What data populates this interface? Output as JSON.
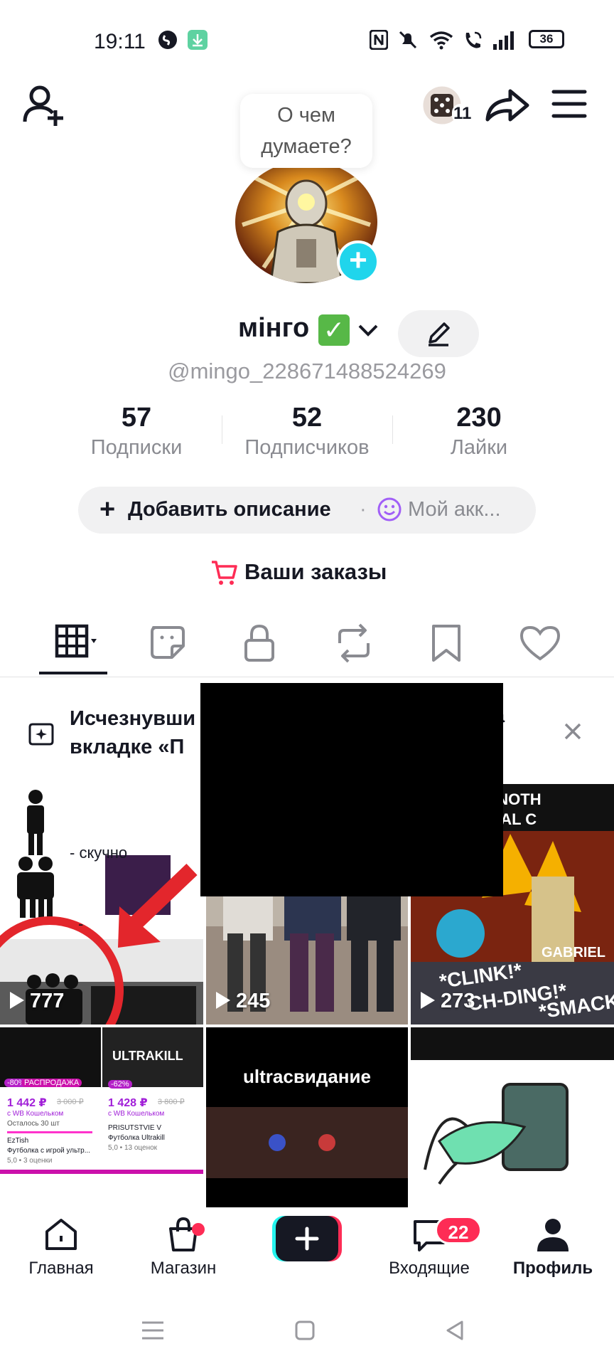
{
  "status_bar": {
    "time": "19:11",
    "battery": "36",
    "icons": [
      "shazam-icon",
      "download-icon",
      "nfc-icon",
      "mute-icon",
      "wifi-icon",
      "wifi-call-icon",
      "signal-icon",
      "battery-icon"
    ]
  },
  "header": {
    "friends_count": "11",
    "thought_bubble": "О чем\nдумаете?"
  },
  "profile": {
    "name": "мінго",
    "handle": "@mingo_228671488524269"
  },
  "stats": [
    {
      "value": "57",
      "label": "Подписки"
    },
    {
      "value": "52",
      "label": "Подписчиков"
    },
    {
      "value": "230",
      "label": "Лайки"
    }
  ],
  "description": {
    "add_label": "Добавить описание",
    "separator": "·",
    "account_label": "Мой акк..."
  },
  "orders_label": "Ваши заказы",
  "tabs": [
    "videos-grid-icon",
    "stickers-icon",
    "lock-icon",
    "repost-icon",
    "bookmark-icon",
    "heart-icon"
  ],
  "banner": {
    "text": "Исчезнувши\nвкладке «П",
    "text_right": "а"
  },
  "grid": {
    "cells": [
      {
        "views": "777",
        "caption_1": "- скучно",
        "caption_2": "-"
      },
      {
        "views": "245"
      },
      {
        "views": "273",
        "top_text": "ELL AND ANOTH\nBY A LITERAL C",
        "fx_1": "*CLINK!*",
        "fx_2": "CH-DING!*",
        "fx_3": "*SMACK!",
        "tag": "GABRIEL"
      },
      {
        "promo_tag": "РАСПРОДАЖА",
        "discount_1": "-80%",
        "price_1": "1 442 ₽",
        "old_price_1": "3 000 ₽",
        "seller_1": "с WB Кошельком",
        "stock": "Осталось 30 шт",
        "store_1": "EzTish",
        "title_1": "Футболка с игрой ультр...",
        "rating_1": "5,0 • 3 оценки",
        "discount_2": "-62%",
        "price_2": "1 428 ₽",
        "old_price_2": "3 800 ₽",
        "seller_2": "с WB Кошельком",
        "store_2": "PRISUTSTVIE V",
        "title_2": "Футболка Ultrakill",
        "rating_2": "5,0 • 13 оценок",
        "shirt_text": "ULTRAKILL"
      },
      {
        "title": "ultracвидание"
      },
      {}
    ]
  },
  "bottom_nav": {
    "items": [
      {
        "label": "Главная"
      },
      {
        "label": "Магазин"
      },
      {
        "label": ""
      },
      {
        "label": "Входящие",
        "badge": "22"
      },
      {
        "label": "Профиль"
      }
    ]
  },
  "colors": {
    "accent": "#fe2c55",
    "cyan": "#20d5ec",
    "text": "#161823",
    "muted": "#8a8b91"
  }
}
